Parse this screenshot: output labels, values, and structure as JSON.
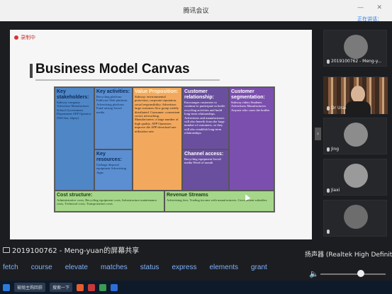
{
  "window": {
    "title": "腾讯会议",
    "status": "正在讲话："
  },
  "recording": {
    "label": "录制中"
  },
  "slide": {
    "title": "Business Model Canvas",
    "stakeholders": {
      "heading": "Key stakeholders:",
      "body": "Subway company Advertiser Manufacturer School Government Department APP Operator (WeChat, alipay)"
    },
    "activities": {
      "heading": "Key activities:",
      "body": "Recycling platform Publicize Web platform Advertising platform Fund raising Social media"
    },
    "resources": {
      "heading": "Key resources:",
      "body": "Garbage disposal equipment Advertising Apps"
    },
    "value": {
      "heading": "Value Proposition:",
      "body": "Subway: environmental protection, corporate reputation, social responsibility. Advertiser: large customer flow group widely distributed. Consumer: convenient social, networking. Manufacturers: a large number of high quality. APP Operators: improve the APP download rate utilization rate."
    },
    "relationship": {
      "heading": "Customer relationship:",
      "body": "Encourages customers to continue to participate in bottle recycling activities and build long-term relationships. Advertisers and manufacturers will also benefit from the large number of customers, so they will also establish long-term relationships."
    },
    "channels": {
      "heading": "Channel access:",
      "body": "Recycling equipment Social media Word of mouth"
    },
    "segments": {
      "heading": "Customer segmentation:",
      "body": "Subway riders Students Advertisers Manufacturers Anyone who cares the bottles"
    },
    "cost": {
      "heading": "Cost structure:",
      "body": "Administrative costs, Recycling equipment costs, Infrastructure maintenance costs, Technical costs, Transportation costs"
    },
    "revenue": {
      "heading": "Revenue Streams",
      "body": "Advertising fees, Trading income with manufacturers, Government subsidies"
    }
  },
  "participants": [
    {
      "name": "2019100762 - Meng-y...",
      "avatar_color": "#7a7a7a"
    },
    {
      "name": "Dr Urai",
      "video": true
    },
    {
      "name": "Jing",
      "avatar_color": "#8c8c8c"
    },
    {
      "name": "Jiaxi",
      "avatar_color": "#9a9a9a"
    },
    {
      "name": "",
      "avatar_color": "#6d6d6d"
    }
  ],
  "share_caption": "2019100762 - Meng-yuan的屏幕共享",
  "speaker": {
    "label": "扬声器 (Realtek High Definition",
    "volume_pct": 62
  },
  "commands": [
    "fetch",
    "course",
    "elevate",
    "matches",
    "status",
    "express",
    "elements",
    "grant"
  ],
  "taskbar": {
    "task_label": "被抛主购回获",
    "search": "搜索一下"
  }
}
